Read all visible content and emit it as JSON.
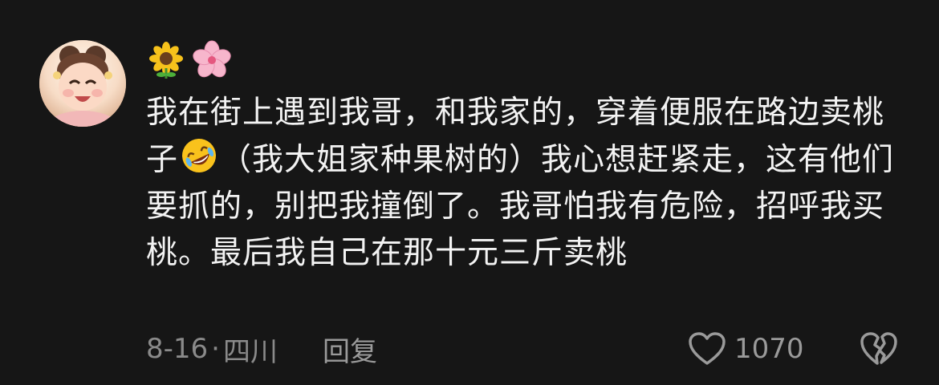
{
  "comment": {
    "user_emojis": [
      "sunflower-emoji",
      "cherry-blossom-emoji"
    ],
    "text_part1": "我在街上遇到我哥，和我家的，穿着便服在路边卖桃子",
    "inline_emoji": "rofl-emoji",
    "text_part2": "（我大姐家种果树的）我心想赶紧走，这有他们要抓的，别把我撞倒了。我哥怕我有危险，招呼我买桃。最后我自己在那十元三斤卖桃",
    "date": "8-16",
    "separator": "·",
    "location": "四川",
    "reply_label": "回复",
    "like_count": "1070"
  },
  "icons": {
    "like": "heart-outline-icon",
    "dislike": "broken-heart-icon"
  },
  "colors": {
    "background": "#161616",
    "text": "#f3f3f3",
    "meta": "#8a8a8a"
  }
}
